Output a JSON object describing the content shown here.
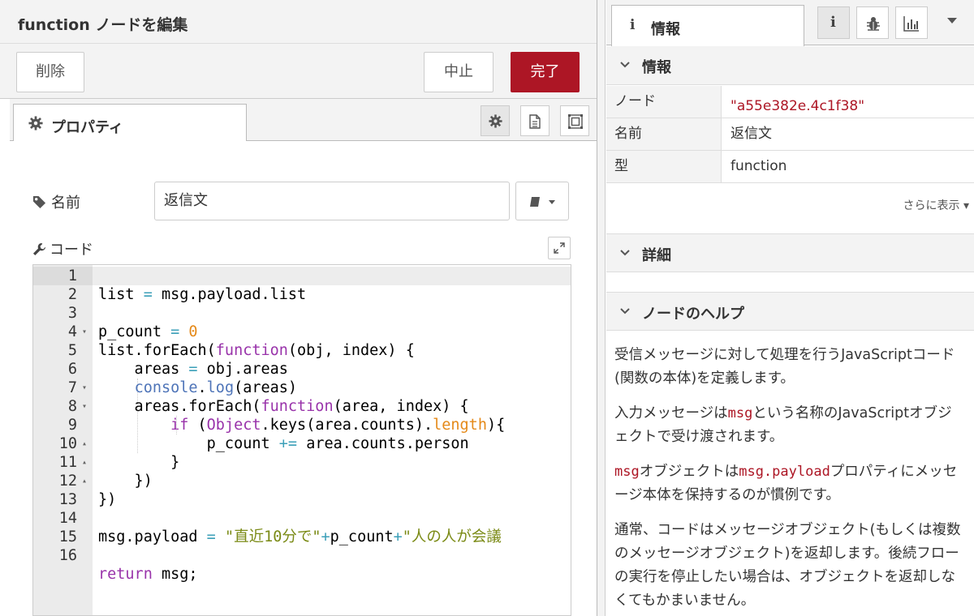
{
  "editor": {
    "title": "function ノードを編集",
    "delete_label": "削除",
    "cancel_label": "中止",
    "done_label": "完了",
    "tab_properties": "プロパティ",
    "name_label": "名前",
    "name_value": "返信文",
    "code_label": "コード",
    "code_lines": [
      {
        "n": "1",
        "fold": ""
      },
      {
        "n": "2",
        "fold": ""
      },
      {
        "n": "3",
        "fold": ""
      },
      {
        "n": "4",
        "fold": "▾"
      },
      {
        "n": "5",
        "fold": ""
      },
      {
        "n": "6",
        "fold": ""
      },
      {
        "n": "7",
        "fold": "▾"
      },
      {
        "n": "8",
        "fold": "▾"
      },
      {
        "n": "9",
        "fold": ""
      },
      {
        "n": "10",
        "fold": "▴"
      },
      {
        "n": "11",
        "fold": "▴"
      },
      {
        "n": "12",
        "fold": "▴"
      },
      {
        "n": "13",
        "fold": ""
      },
      {
        "n": "14",
        "fold": ""
      },
      {
        "n": "15",
        "fold": ""
      },
      {
        "n": "16",
        "fold": ""
      }
    ],
    "code": {
      "l1_a": "list",
      "l1_op": " = ",
      "l1_b": "msg.payload.list",
      "l3_a": "p_count",
      "l3_op": " = ",
      "l3_num": "0",
      "l4_a": "list.forEach(",
      "l4_kw": "function",
      "l4_b": "(obj, index) {",
      "l5_a": "    areas",
      "l5_op": " = ",
      "l5_b": "obj.areas",
      "l6_fn": "console",
      "l6_a": ".",
      "l6_fn2": "log",
      "l6_b": "(areas)",
      "l7_a": "    areas.forEach(",
      "l7_kw": "function",
      "l7_b": "(area, index) {",
      "l8_kw": "if",
      "l8_a": " (",
      "l8_kw2": "Object",
      "l8_b": ".keys(area.counts).",
      "l8_num": "length",
      "l8_c": "){",
      "l9_a": "p_count",
      "l9_op": " += ",
      "l9_b": "area.counts.person",
      "l10_a": "}",
      "l11_a": "    })",
      "l12_a": "})",
      "l14_a": "msg.payload",
      "l14_op": " = ",
      "l14_str": "\"直近10分で\"",
      "l14_op2": "+",
      "l14_b": "p_count",
      "l14_op3": "+",
      "l14_str2": "\"人の人が会議",
      "l16_kw": "return",
      "l16_b": " msg;"
    }
  },
  "sidebar": {
    "tab_label": "情報",
    "info_section": "情報",
    "rows": [
      {
        "key": "ノード",
        "value": "\"a55e382e.4c1f38\""
      },
      {
        "key": "名前",
        "value": "返信文"
      },
      {
        "key": "型",
        "value": "function"
      }
    ],
    "more_label": "さらに表示 ▾",
    "details_section": "詳細",
    "help_section": "ノードのヘルプ",
    "help": {
      "p1": "受信メッセージに対して処理を行うJavaScriptコード(関数の本体)を定義します。",
      "p2_a": "入力メッセージは",
      "p2_code": "msg",
      "p2_b": "という名称のJavaScriptオブジェクトで受け渡されます。",
      "p3_code": "msg",
      "p3_a": "オブジェクトは",
      "p3_code2": "msg.payload",
      "p3_b": "プロパティにメッセージ本体を保持するのが慣例です。",
      "p4": "通常、コードはメッセージオブジェクト(もしくは複数のメッセージオブジェクト)を返却します。後続フローの実行を停止したい場合は、オブジェクトを返却しなくてもかまいません。"
    }
  }
}
